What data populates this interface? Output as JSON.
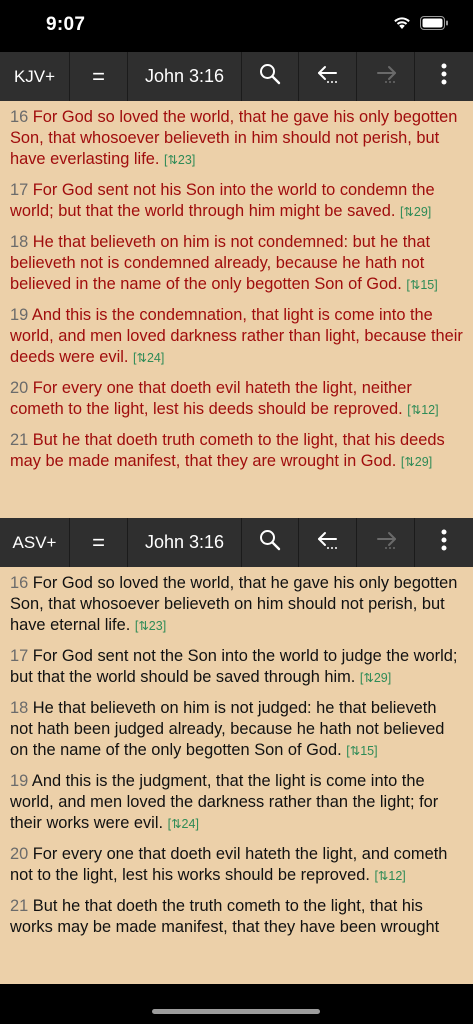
{
  "status": {
    "time": "9:07"
  },
  "top_pane": {
    "toolbar": {
      "version": "KJV+",
      "compare": "=",
      "reference": "John 3:16"
    },
    "verses": [
      {
        "num": "16",
        "text": "For God so loved the world, that he gave his only begotten Son, that whosoever believeth in him should not perish, but have everlasting life.",
        "xref": "[⇅23]"
      },
      {
        "num": "17",
        "text": "For God sent not his Son into the world to condemn the world; but that the world through him might be saved.",
        "xref": "[⇅29]"
      },
      {
        "num": "18",
        "text": "He that believeth on him is not condemned: but he that believeth not is condemned already, because he hath not believed in the name of the only begotten Son of God.",
        "xref": "[⇅15]"
      },
      {
        "num": "19",
        "text": "And this is the condemnation, that light is come into the world, and men loved darkness rather than light, because their deeds were evil.",
        "xref": "[⇅24]"
      },
      {
        "num": "20",
        "text": "For every one that doeth evil hateth the light, neither cometh to the light, lest his deeds should be reproved.",
        "xref": "[⇅12]"
      },
      {
        "num": "21",
        "text": "But he that doeth truth cometh to the light, that his deeds may be made manifest, that they are wrought in God.",
        "xref": "[⇅29]"
      }
    ]
  },
  "bottom_pane": {
    "toolbar": {
      "version": "ASV+",
      "compare": "=",
      "reference": "John 3:16"
    },
    "verses": [
      {
        "num": "16",
        "text": "For God so loved the world, that he gave his only begotten Son, that whosoever believeth on him should not perish, but have eternal life.",
        "xref": "[⇅23]"
      },
      {
        "num": "17",
        "text": "For God sent not the Son into the world to judge the world; but that the world should be saved through him.",
        "xref": "[⇅29]"
      },
      {
        "num": "18",
        "text": "He that believeth on him is not judged: he that believeth not hath been judged already, because he hath not believed on the name of the only begotten Son of God.",
        "xref": "[⇅15]"
      },
      {
        "num": "19",
        "text": "And this is the judgment, that the light is come into the world, and men loved the darkness rather than the light; for their works were evil.",
        "xref": "[⇅24]"
      },
      {
        "num": "20",
        "text": "For every one that doeth evil hateth the light, and cometh not to the light, lest his works should be reproved.",
        "xref": "[⇅12]"
      },
      {
        "num": "21",
        "text": "But he that doeth the truth cometh to the light, that his works may be made manifest, that they have been wrought",
        "xref": ""
      }
    ]
  },
  "icons": {
    "search": "magnifier-icon",
    "back": "back-arrow-icon",
    "forward": "forward-arrow-icon",
    "menu": "vertical-dots-icon"
  },
  "colors": {
    "toolbar_bg": "#2f2f2f",
    "pane_bg": "#ecd0a9",
    "kjv_text": "#a00d0d",
    "asv_text": "#111111",
    "verse_number": "#6b6b6b",
    "xref": "#2e8b57"
  }
}
